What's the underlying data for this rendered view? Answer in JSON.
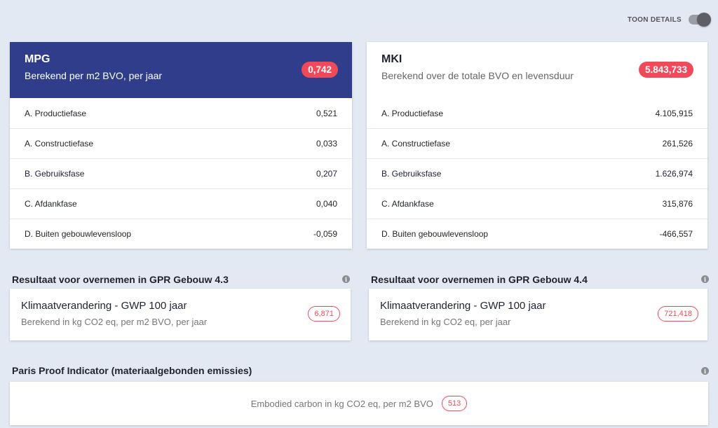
{
  "toggle": {
    "label": "TOON DETAILS",
    "state": "on"
  },
  "mpg": {
    "title": "MPG",
    "subtitle": "Berekend per m2 BVO, per jaar",
    "total": "0,742",
    "rows": [
      {
        "label": "A. Productiefase",
        "value": "0,521"
      },
      {
        "label": "A. Constructiefase",
        "value": "0,033"
      },
      {
        "label": "B. Gebruiksfase",
        "value": "0,207"
      },
      {
        "label": "C. Afdankfase",
        "value": "0,040"
      },
      {
        "label": "D. Buiten gebouwlevensloop",
        "value": "-0,059"
      }
    ]
  },
  "mki": {
    "title": "MKI",
    "subtitle": "Berekend over de totale BVO en levensduur",
    "total": "5.843,733",
    "rows": [
      {
        "label": "A. Productiefase",
        "value": "4.105,915"
      },
      {
        "label": "A. Constructiefase",
        "value": "261,526"
      },
      {
        "label": "B. Gebruiksfase",
        "value": "1.626,974"
      },
      {
        "label": "C. Afdankfase",
        "value": "315,876"
      },
      {
        "label": "D. Buiten gebouwlevensloop",
        "value": "-466,557"
      }
    ]
  },
  "gpr43": {
    "section_title": "Resultaat voor overnemen in GPR Gebouw 4.3",
    "title": "Klimaatverandering - GWP 100 jaar",
    "subtitle": "Berekend in kg CO2 eq, per m2 BVO, per jaar",
    "value": "6,871"
  },
  "gpr44": {
    "section_title": "Resultaat voor overnemen in GPR Gebouw 4.4",
    "title": "Klimaatverandering - GWP 100 jaar",
    "subtitle": "Berekend in kg CO2 eq, per jaar",
    "value": "721,418"
  },
  "paris": {
    "section_title": "Paris Proof Indicator (materiaalgebonden emissies)",
    "text": "Embodied carbon in kg CO2 eq, per m2 BVO",
    "value": "513"
  },
  "colors": {
    "accent": "#2f3d8a",
    "badge": "#ef4a5a",
    "background": "#e3e9f3"
  },
  "icons": {
    "info": "info-icon"
  }
}
